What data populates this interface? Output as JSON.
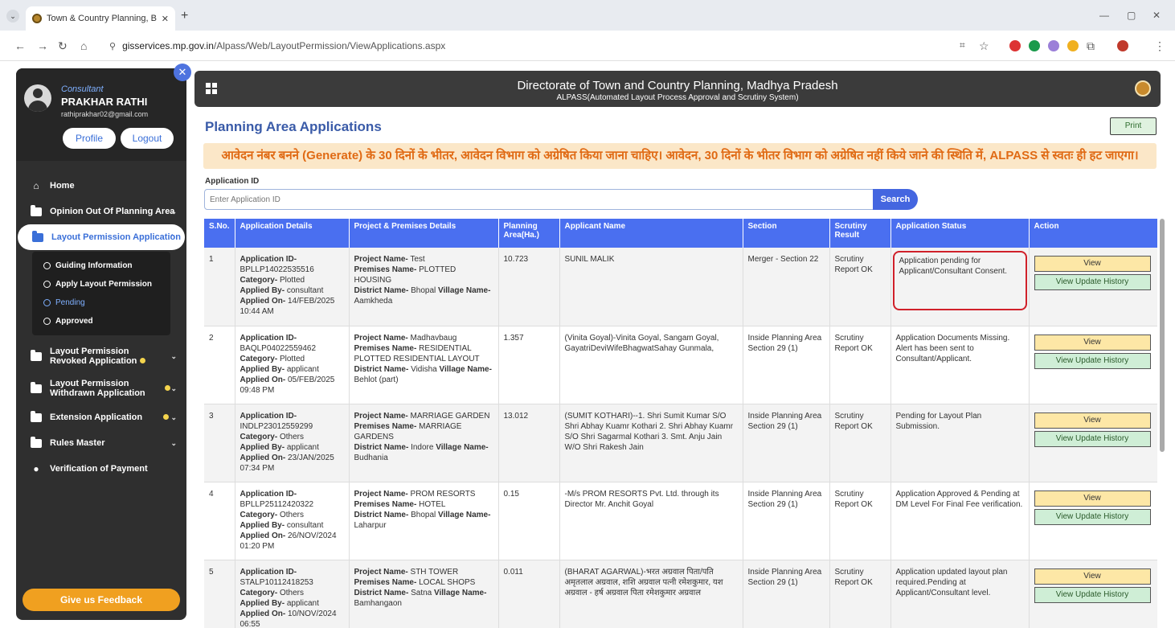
{
  "browser": {
    "tab_title": "Town & Country Planning, Bhopal",
    "url_domain": "gisservices.mp.gov.in",
    "url_path": "/Alpass/Web/LayoutPermission/ViewApplications.aspx"
  },
  "user": {
    "role": "Consultant",
    "name": "PRAKHAR RATHI",
    "email": "rathiprakhar02@gmail.com",
    "profile_label": "Profile",
    "logout_label": "Logout"
  },
  "sidebar": {
    "home": "Home",
    "opinion": "Opinion Out Of Planning Area",
    "layout_permission": "Layout Permission Application",
    "sub": [
      "Guiding Information",
      "Apply Layout Permission",
      "Pending",
      "Approved"
    ],
    "revoked": "Layout Permission Revoked Application",
    "withdrawn": "Layout Permission Withdrawn Application",
    "extension": "Extension Application",
    "rules": "Rules Master",
    "verification": "Verification of Payment",
    "feedback": "Give us Feedback"
  },
  "header": {
    "title": "Directorate of Town and Country Planning, Madhya Pradesh",
    "subtitle": "ALPASS(Automated Layout Process Approval and Scrutiny System)"
  },
  "page": {
    "title": "Planning Area Applications",
    "print_label": "Print",
    "notice": "आवेदन नंबर बनने (Generate) के 30 दिनों के भीतर, आवेदन विभाग को अग्रेषित किया जाना चाहिए। आवेदन, 30 दिनों के भीतर विभाग को अग्रेषित नहीं किये जाने की स्थिति में, ALPASS से स्वतः ही हट जाएगा।",
    "app_id_label": "Application ID",
    "app_id_placeholder": "Enter Application ID",
    "search_label": "Search"
  },
  "table": {
    "headers": [
      "S.No.",
      "Application Details",
      "Project & Premises Details",
      "Planning Area(Ha.)",
      "Applicant Name",
      "Section",
      "Scrutiny Result",
      "Application Status",
      "Action"
    ],
    "labels": {
      "app_id": "Application ID-",
      "category": "Category-",
      "applied_by": "Applied By-",
      "applied_on": "Applied On-",
      "project_name": "Project Name-",
      "premises_name": "Premises Name-",
      "district_name": "District Name-",
      "village_name": "Village Name-",
      "view": "View",
      "view_history": "View Update History"
    },
    "rows": [
      {
        "sno": "1",
        "app_id": "BPLLP14022535516",
        "category": "Plotted",
        "applied_by": "consultant",
        "applied_on": "14/FEB/2025 10:44 AM",
        "project": "Test",
        "premises": "PLOTTED HOUSING",
        "district": "Bhopal",
        "village": "Aamkheda",
        "area": "10.723",
        "applicant": "SUNIL MALIK",
        "section": "Merger - Section 22",
        "scrutiny": "Scrutiny Report OK",
        "status": "Application pending for Applicant/Consultant Consent."
      },
      {
        "sno": "2",
        "app_id": "BAQLP04022559462",
        "category": "Plotted",
        "applied_by": "applicant",
        "applied_on": "05/FEB/2025 09:48 PM",
        "project": "Madhavbaug",
        "premises": "RESIDENTIAL PLOTTED RESIDENTIAL LAYOUT",
        "district": "Vidisha",
        "village": "Behlot (part)",
        "area": "1.357",
        "applicant": "(Vinita Goyal)-Vinita Goyal, Sangam Goyal, GayatriDeviWifeBhagwatSahay Gunmala,",
        "section": "Inside Planning Area Section 29 (1)",
        "scrutiny": "Scrutiny Report OK",
        "status": "Application Documents Missing. Alert has been sent to Consultant/Applicant."
      },
      {
        "sno": "3",
        "app_id": "INDLP23012559299",
        "category": "Others",
        "applied_by": "applicant",
        "applied_on": "23/JAN/2025 07:34 PM",
        "project": "MARRIAGE GARDEN",
        "premises": "MARRIAGE GARDENS",
        "district": "Indore",
        "village": "Budhania",
        "area": "13.012",
        "applicant": "(SUMIT KOTHARI)--1. Shri Sumit Kumar S/O Shri Abhay Kuamr Kothari 2. Shri Abhay Kuamr S/O Shri Sagarmal Kothari 3. Smt. Anju Jain W/O Shri Rakesh Jain",
        "section": "Inside Planning Area Section 29 (1)",
        "scrutiny": "Scrutiny Report OK",
        "status": "Pending for Layout Plan Submission."
      },
      {
        "sno": "4",
        "app_id": "BPLLP25112420322",
        "category": "Others",
        "applied_by": "consultant",
        "applied_on": "26/NOV/2024 01:20 PM",
        "project": "PROM RESORTS",
        "premises": "HOTEL",
        "district": "Bhopal",
        "village": "Laharpur",
        "area": "0.15",
        "applicant": "-M/s PROM RESORTS Pvt. Ltd. through its Director Mr. Anchit Goyal",
        "section": "Inside Planning Area Section 29 (1)",
        "scrutiny": "Scrutiny Report OK",
        "status": "Application Approved & Pending at DM Level For Final Fee verification."
      },
      {
        "sno": "5",
        "app_id": "STALP10112418253",
        "category": "Others",
        "applied_by": "applicant",
        "applied_on": "10/NOV/2024 06:55",
        "project": "STH TOWER",
        "premises": "LOCAL SHOPS",
        "district": "Satna",
        "village": "Bamhangaon",
        "area": "0.011",
        "applicant": "(BHARAT AGARWAL)-भरत अग्रवाल पिता/पति अमृतलाल अग्रवाल, शशि अग्रवाल पत्नी रमेशकुमार, यश अग्रवाल - हर्ष अग्रवाल पिता रमेशकुमार अग्रवाल",
        "section": "Inside Planning Area Section 29 (1)",
        "scrutiny": "Scrutiny Report OK",
        "status": "Application updated layout plan required.Pending at Applicant/Consultant level."
      }
    ]
  },
  "colors": {
    "accent": "#4a6ff0",
    "notice_bg": "#fbe7c8",
    "notice_text": "#e06a14",
    "highlight": "#d0202a"
  }
}
